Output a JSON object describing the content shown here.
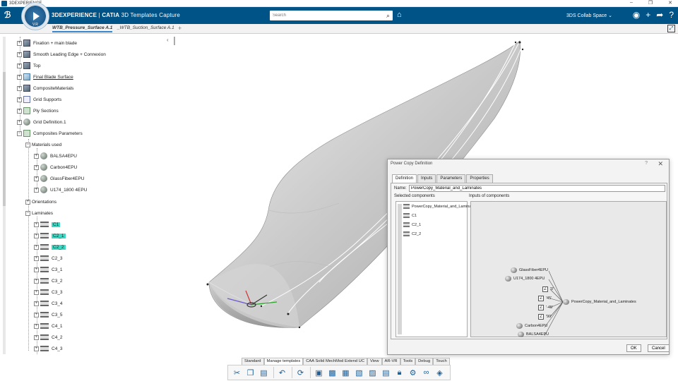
{
  "os_window": {
    "title": "3DEXPERIENCE",
    "controls": [
      "–",
      "❐",
      "✕"
    ]
  },
  "app_bar": {
    "brand": "3DEXPERIENCE",
    "product": "CATIA",
    "app_name": "3D Templates Capture",
    "compass_version": "V.R",
    "search_placeholder": "Search",
    "collab_space": "3DS Collab Space",
    "accent_color": "#005386"
  },
  "doc_tabs": [
    {
      "label": "WTB_Pressure_Surface A.1",
      "active": true
    },
    {
      "label": "_WTB_Suction_Surface A.1",
      "active": false
    }
  ],
  "tree": {
    "items": [
      {
        "label": "Fixation + main blade",
        "icon": "part-icon"
      },
      {
        "label": "Smooth Leading Edge + Connexion",
        "icon": "part-icon"
      },
      {
        "label": "Top",
        "icon": "part-icon"
      },
      {
        "label": "Final Blade Surface",
        "icon": "surface-icon",
        "underline": true
      },
      {
        "label": "CompositeMaterials",
        "icon": "part-icon"
      },
      {
        "label": "Grid Supports",
        "icon": "grid-icon"
      },
      {
        "label": "Ply Sections",
        "icon": "ply-icon"
      },
      {
        "label": "Grid Definition.1",
        "icon": "grid-def-icon"
      },
      {
        "label": "Composites Parameters",
        "icon": "params-icon"
      },
      {
        "label": "Materials used",
        "icon": ""
      },
      {
        "label": "BALSA4EPU",
        "icon": "material-icon"
      },
      {
        "label": "Carbon4EPU",
        "icon": "material-icon"
      },
      {
        "label": "GlassFiber4EPU",
        "icon": "material-icon"
      },
      {
        "label": "U174_1800 4EPU",
        "icon": "material-icon"
      },
      {
        "label": "Orientations",
        "icon": ""
      },
      {
        "label": "Laminates",
        "icon": ""
      },
      {
        "label": "C1",
        "icon": "laminate-icon",
        "highlight": true
      },
      {
        "label": "C2_1",
        "icon": "laminate-icon",
        "highlight": true
      },
      {
        "label": "C2_2",
        "icon": "laminate-icon",
        "highlight": true
      },
      {
        "label": "C2_3",
        "icon": "laminate-icon"
      },
      {
        "label": "C3_1",
        "icon": "laminate-icon"
      },
      {
        "label": "C3_2",
        "icon": "laminate-icon"
      },
      {
        "label": "C3_3",
        "icon": "laminate-icon"
      },
      {
        "label": "C3_4",
        "icon": "laminate-icon"
      },
      {
        "label": "C3_5",
        "icon": "laminate-icon"
      },
      {
        "label": "C4_1",
        "icon": "laminate-icon"
      },
      {
        "label": "C4_2",
        "icon": "laminate-icon"
      },
      {
        "label": "C4_3",
        "icon": "laminate-icon"
      }
    ],
    "highlight_color": "#3fd7c4"
  },
  "dialog": {
    "title": "Power Copy Definition",
    "help": "?",
    "close": "✕",
    "tabs": [
      "Definition",
      "Inputs",
      "Parameters",
      "Properties"
    ],
    "name_label": "Name:",
    "name_value": "PowerCopy_Material_and_Laminates",
    "selected_label": "Selected components",
    "inputs_label": "Inputs of components",
    "selected_items": [
      "PowerCopy_Material_and_Lamina",
      "C1",
      "C2_1",
      "C2_2"
    ],
    "nodes": {
      "glass": "GlassFiber4EPU",
      "u174": "U174_1800 4EPU",
      "a0": "'0'",
      "a45": "'45'",
      "am45": "'-45'",
      "a90": "'90'",
      "carbon": "Carbon4EPU",
      "balsa": "BALSA4EPU",
      "result": "PowerCopy_Material_and_Laminates"
    },
    "ok": "OK",
    "cancel": "Cancel"
  },
  "bottom_tabs": [
    "Standard",
    "Manage templates",
    "CAA Solid MechMod Extend UC",
    "View",
    "AR-VR",
    "Tools",
    "Debug",
    "Touch"
  ],
  "bottom_active_tab": "Manage templates",
  "toolbar_icons": [
    "cut-icon",
    "copy-icon",
    "paste-icon",
    "undo-icon",
    "update-icon",
    "template-icon",
    "powercopy-icon",
    "udf-icon",
    "document-template-icon",
    "instantiate-icon",
    "catalog-icon",
    "lock-icon",
    "reference-icon",
    "link-icon",
    "knowledge-icon"
  ]
}
